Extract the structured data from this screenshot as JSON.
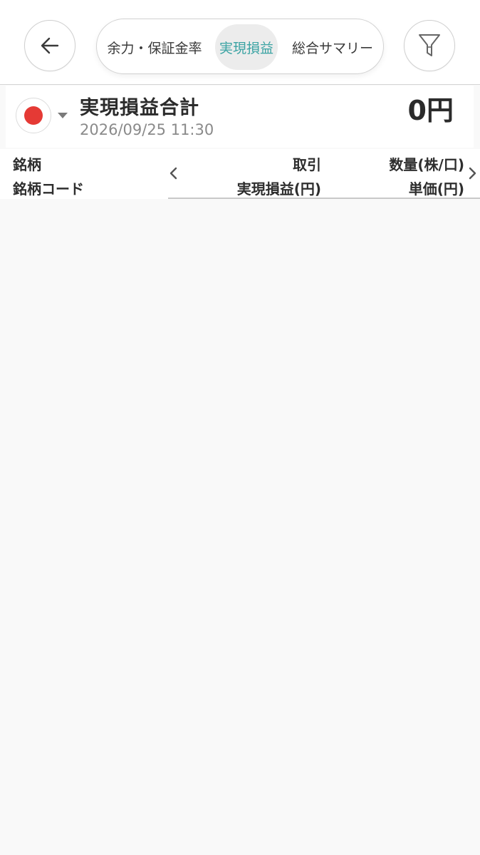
{
  "header": {
    "tabs": [
      {
        "label": "余力・保証金率"
      },
      {
        "label": "実現損益",
        "active": true
      },
      {
        "label": "総合サマリー"
      }
    ],
    "back_icon": "arrow-left-icon",
    "filter_icon": "filter-icon"
  },
  "summary": {
    "title": "実現損益合計",
    "datetime": "2026/09/25 11:30",
    "value": "0円",
    "market_flag_color": "#e53a35"
  },
  "columns": {
    "left_top": "銘柄",
    "left_bottom": "銘柄コード",
    "mid_top": "取引",
    "mid_bottom": "実現損益(円)",
    "right_top": "数量(株/口)",
    "right_bottom": "単価(円)"
  },
  "colors": {
    "active_tab_text": "#3aa3a3",
    "background": "#f9f9f9"
  }
}
